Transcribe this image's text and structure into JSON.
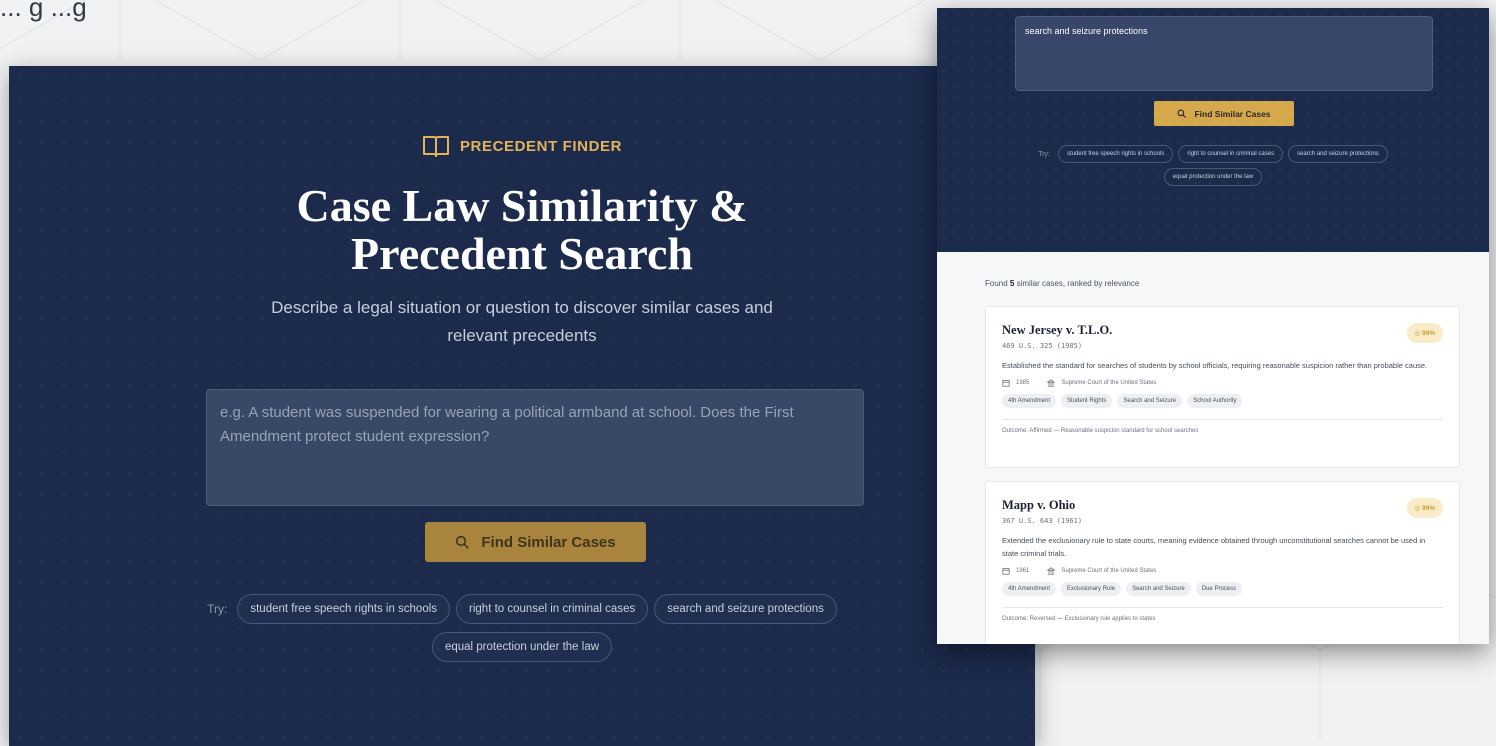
{
  "backdrop": {
    "partial_text": "... g ...g"
  },
  "landing": {
    "brand": {
      "name": "PRECEDENT FINDER",
      "icon": "book-icon"
    },
    "title_line1": "Case Law Similarity &",
    "title_line2": "Precedent Search",
    "subtitle": "Describe a legal situation or question to discover similar cases and relevant precedents",
    "search": {
      "placeholder": "e.g. A student was suspended for wearing a political armband at school. Does the First Amendment protect student expression?"
    },
    "button_label": "Find Similar Cases",
    "button_icon": "search-icon",
    "try_label": "Try:",
    "suggestions": [
      "student free speech rights in schools",
      "right to counsel in criminal cases",
      "search and seizure protections",
      "equal protection under the law"
    ],
    "colors": {
      "navy": "#1c2a4c",
      "gold": "#e3b35a",
      "button": "#a8843c"
    }
  },
  "results_view": {
    "query": "search and seizure protections",
    "button_label": "Find Similar Cases",
    "try_label": "Try:",
    "suggestions": [
      "student free speech rights in schools",
      "right to counsel in criminal cases",
      "search and seizure protections",
      "equal protection under the law"
    ],
    "found_prefix": "Found",
    "found_count": "5",
    "found_suffix": "similar cases, ranked by relevance",
    "cases": [
      {
        "title": "New Jersey v. T.L.O.",
        "citation": "469 U.S. 325 (1985)",
        "score": "99%",
        "summary": "Established the standard for searches of students by school officials, requiring reasonable suspicion rather than probable cause.",
        "year": "1985",
        "court": "Supreme Court of the United States",
        "tags": [
          "4th Amendment",
          "Student Rights",
          "Search and Seizure",
          "School Authority"
        ],
        "outcome": "Outcome: Affirmed — Reasonable suspicion standard for school searches"
      },
      {
        "title": "Mapp v. Ohio",
        "citation": "367 U.S. 643 (1961)",
        "score": "99%",
        "summary": "Extended the exclusionary rule to state courts, meaning evidence obtained through unconstitutional searches cannot be used in state criminal trials.",
        "year": "1961",
        "court": "Supreme Court of the United States",
        "tags": [
          "4th Amendment",
          "Exclusionary Rule",
          "Search and Seizure",
          "Due Process"
        ],
        "outcome": "Outcome: Reversed — Exclusionary rule applies to states"
      }
    ]
  }
}
